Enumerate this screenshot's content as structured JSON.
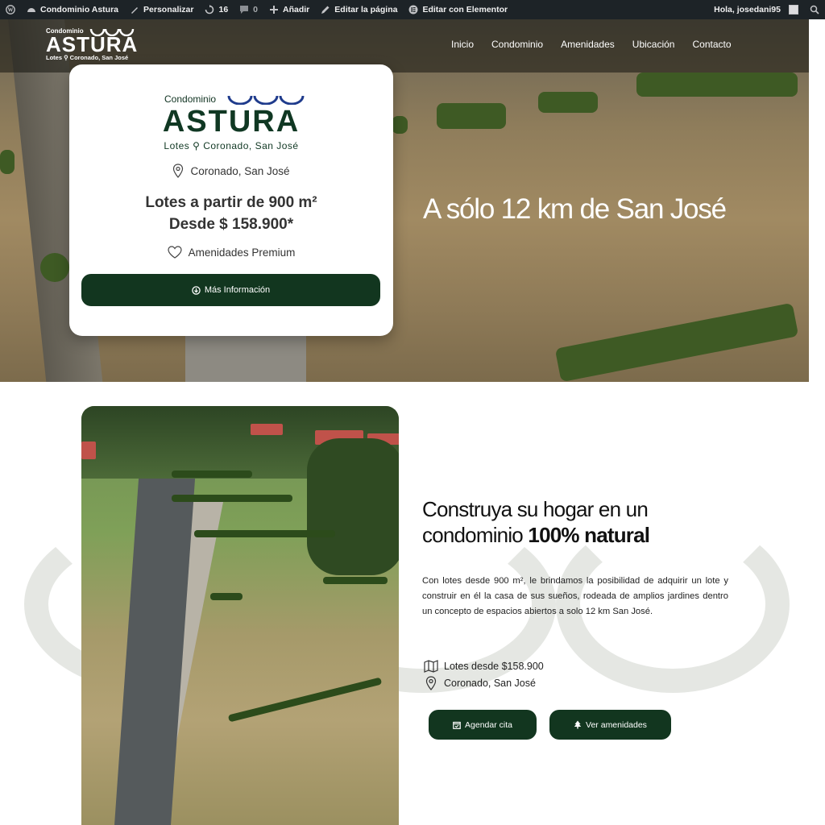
{
  "admin_bar": {
    "site_name": "Condominio Astura",
    "customize": "Personalizar",
    "updates_count": "16",
    "comments_count": "0",
    "add_new": "Añadir",
    "edit_page": "Editar la página",
    "edit_elementor": "Editar con Elementor",
    "greeting": "Hola, josedani95"
  },
  "header": {
    "logo_small": "Condominio",
    "logo_big": "ASTURA",
    "logo_location": "Lotes ⚲ Coronado, San José",
    "nav": [
      "Inicio",
      "Condominio",
      "Amenidades",
      "Ubicación",
      "Contacto"
    ]
  },
  "hero": {
    "headline": "A sólo 12 km de San José"
  },
  "card": {
    "logo_small": "Condominio",
    "logo_big": "ASTURA",
    "logo_location": "Lotes ⚲ Coronado, San José",
    "location": "Coronado, San José",
    "price_line1": "Lotes a partir de 900 m²",
    "price_line2": "Desde $ 158.900*",
    "amenities": "Amenidades Premium",
    "button": "Más Información"
  },
  "section2": {
    "title_line1": "Construya su hogar en un",
    "title_line2_plain": "condominio ",
    "title_line2_bold": "100% natural",
    "description": "Con lotes desde 900 m², le brindamos la posibilidad de adquirir un lote y construir en él la casa de sus sueños, rodeada de amplios jardines dentro un concepto de espacios abiertos a solo 12 km San José.",
    "item_price": "Lotes desde $158.900",
    "item_location": "Coronado, San José",
    "btn_schedule": "Agendar cita",
    "btn_amenities": "Ver amenidades"
  },
  "colors": {
    "brand_green": "#12361f",
    "admin_bar": "#1d2327",
    "accent_blue": "#1f3b8c"
  }
}
